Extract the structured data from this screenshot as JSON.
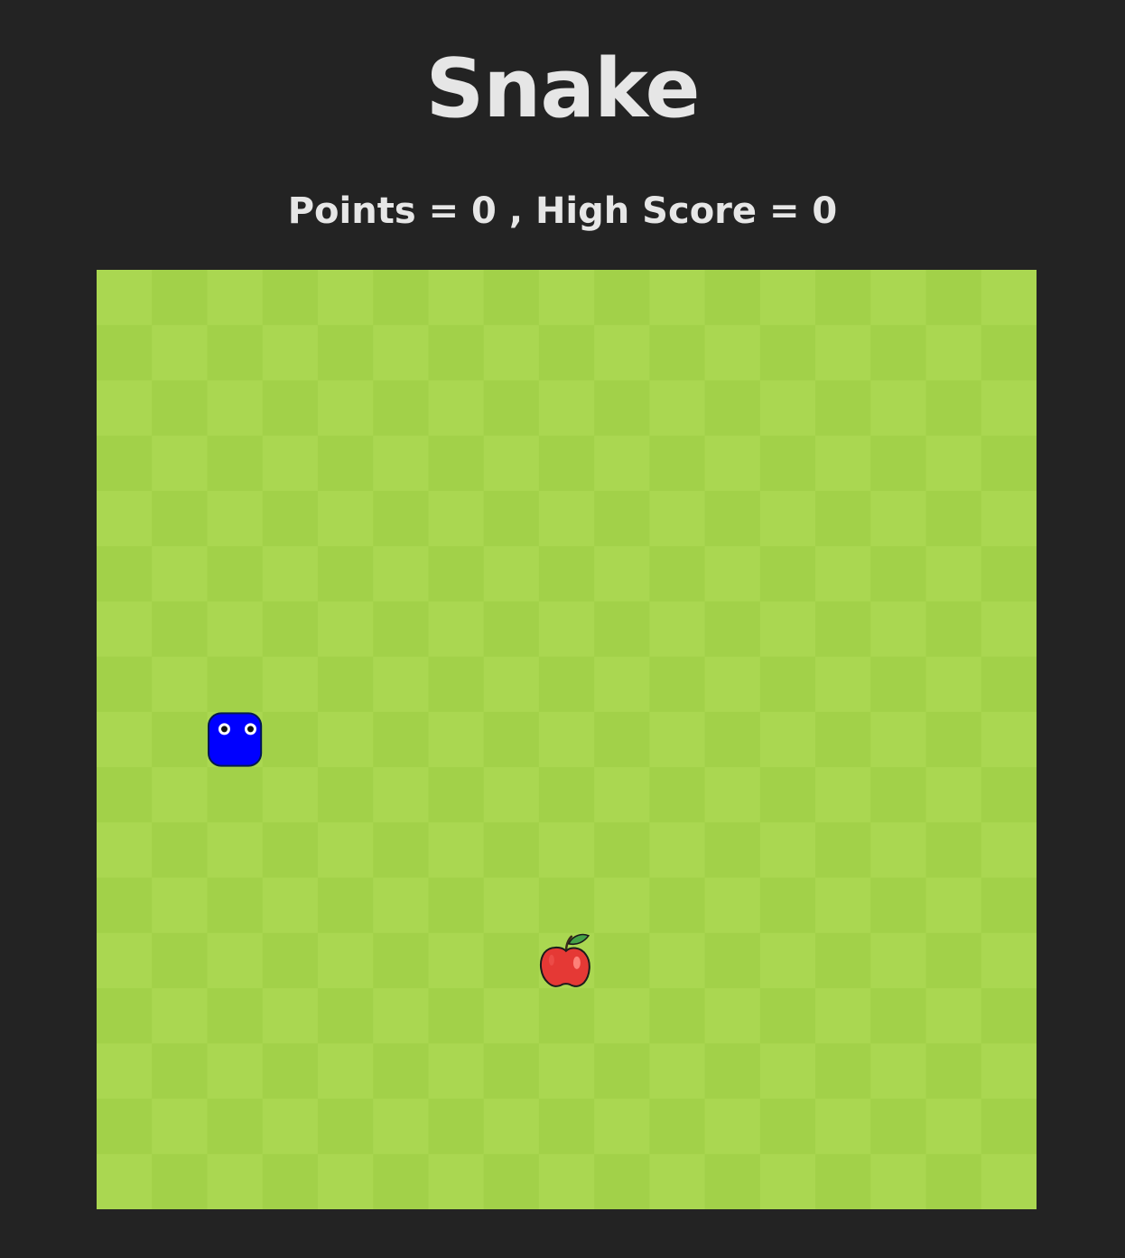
{
  "game": {
    "title": "Snake",
    "points_label": "Points",
    "points": 0,
    "separator": ",",
    "high_score_label": "High Score",
    "high_score": 0
  },
  "board": {
    "columns": 17,
    "rows": 17,
    "colors": {
      "tile_light": "#aad751",
      "tile_dark": "#a2d149",
      "background": "#232323",
      "text": "#e6e6e6",
      "snake_body": "#0000ff",
      "snake_outline": "#001a4d",
      "apple": "#e53935",
      "apple_leaf": "#43a047"
    },
    "snake": {
      "segments": [
        {
          "col": 2,
          "row": 8
        }
      ],
      "head_icon": "snake-head-icon"
    },
    "apple": {
      "col": 8,
      "row": 12,
      "icon": "apple-icon"
    }
  }
}
